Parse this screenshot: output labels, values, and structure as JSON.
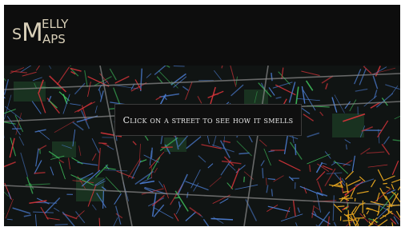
{
  "logo": {
    "s": "S",
    "m": "M",
    "elly": "ELLY",
    "aps": "APS"
  },
  "banner": {
    "text": "Click on a street to see how it smells"
  },
  "colors": {
    "header_bg": "#0d0d0d",
    "map_bg": "#101413",
    "street_blue": "#4d7fd6",
    "street_red": "#d8343a",
    "street_green": "#3fbf5c",
    "street_orange": "#e0a21f",
    "park_green": "#1c3a24"
  },
  "map": {
    "type": "street smell map",
    "icon": "map-view"
  }
}
